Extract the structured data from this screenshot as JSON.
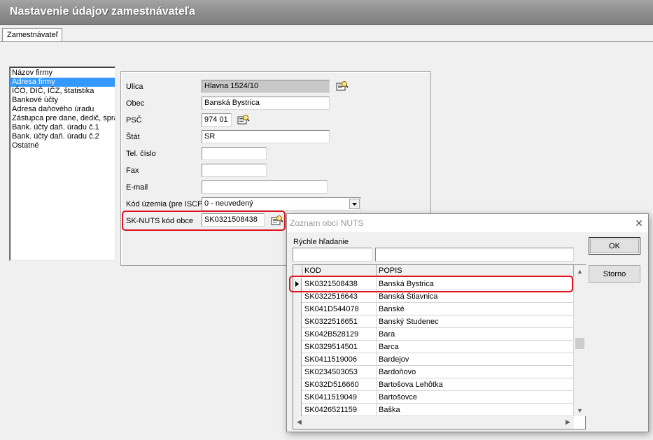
{
  "window": {
    "title": "Nastavenie údajov zamestnávateľa"
  },
  "tabs": [
    {
      "label": "Zamestnávateľ"
    }
  ],
  "sections": [
    {
      "label": "Názov firmy"
    },
    {
      "label": "Adresa firmy"
    },
    {
      "label": "IČO, DIČ, IČZ, štatistika"
    },
    {
      "label": "Bankové účty"
    },
    {
      "label": "Adresa daňového úradu"
    },
    {
      "label": "Zástupca pre dane, dedič, správ"
    },
    {
      "label": "Bank. účty daň. úradu č.1"
    },
    {
      "label": "Bank. účty daň. úradu č.2"
    },
    {
      "label": "Ostatné"
    }
  ],
  "form": {
    "ulica": {
      "label": "Ulica",
      "value": "Hlavna 1524/10"
    },
    "obec": {
      "label": "Obec",
      "value": "Banská Bystrica"
    },
    "psc": {
      "label": "PSČ",
      "value": "974 01"
    },
    "stat": {
      "label": "Štát",
      "value": "SR"
    },
    "tel": {
      "label": "Tel. číslo",
      "value": ""
    },
    "fax": {
      "label": "Fax",
      "value": ""
    },
    "email": {
      "label": "E-mail",
      "value": ""
    },
    "kod_uzemia": {
      "label": "Kód územia (pre ISCP)",
      "value": "0 - neuvedený"
    },
    "sknuts": {
      "label": "SK-NUTS kód obce",
      "value": "SK0321508438"
    }
  },
  "dialog": {
    "title": "Zoznam obcí NUTS",
    "close": "✕",
    "quick_search_label": "Rýchle hľadanie",
    "search_code": "",
    "search_name": "",
    "ok_label": "OK",
    "cancel_label": "Storno",
    "columns": [
      "KOD",
      "POPIS"
    ],
    "rows": [
      {
        "kod": "SK0321508438",
        "popis": "Banská Bystrica"
      },
      {
        "kod": "SK0322516643",
        "popis": "Banská Štiavnica"
      },
      {
        "kod": "SK041D544078",
        "popis": "Banské"
      },
      {
        "kod": "SK0322516651",
        "popis": "Banský Studenec"
      },
      {
        "kod": "SK042B528129",
        "popis": "Bara"
      },
      {
        "kod": "SK0329514501",
        "popis": "Barca"
      },
      {
        "kod": "SK0411519006",
        "popis": "Bardejov"
      },
      {
        "kod": "SK0234503053",
        "popis": "Bardoňovo"
      },
      {
        "kod": "SK032D516660",
        "popis": "Bartošova Lehôtka"
      },
      {
        "kod": "SK0411519049",
        "popis": "Bartošovce"
      },
      {
        "kod": "SK0426521159",
        "popis": "Baška"
      }
    ]
  },
  "colors": {
    "highlight": "#e0141e",
    "selection": "#3399ff",
    "header": "#8e8e8e"
  },
  "icons": {
    "lookup": "lookup-icon",
    "dropdown": "chevron-down-icon",
    "row_pointer": "row-pointer-icon"
  }
}
